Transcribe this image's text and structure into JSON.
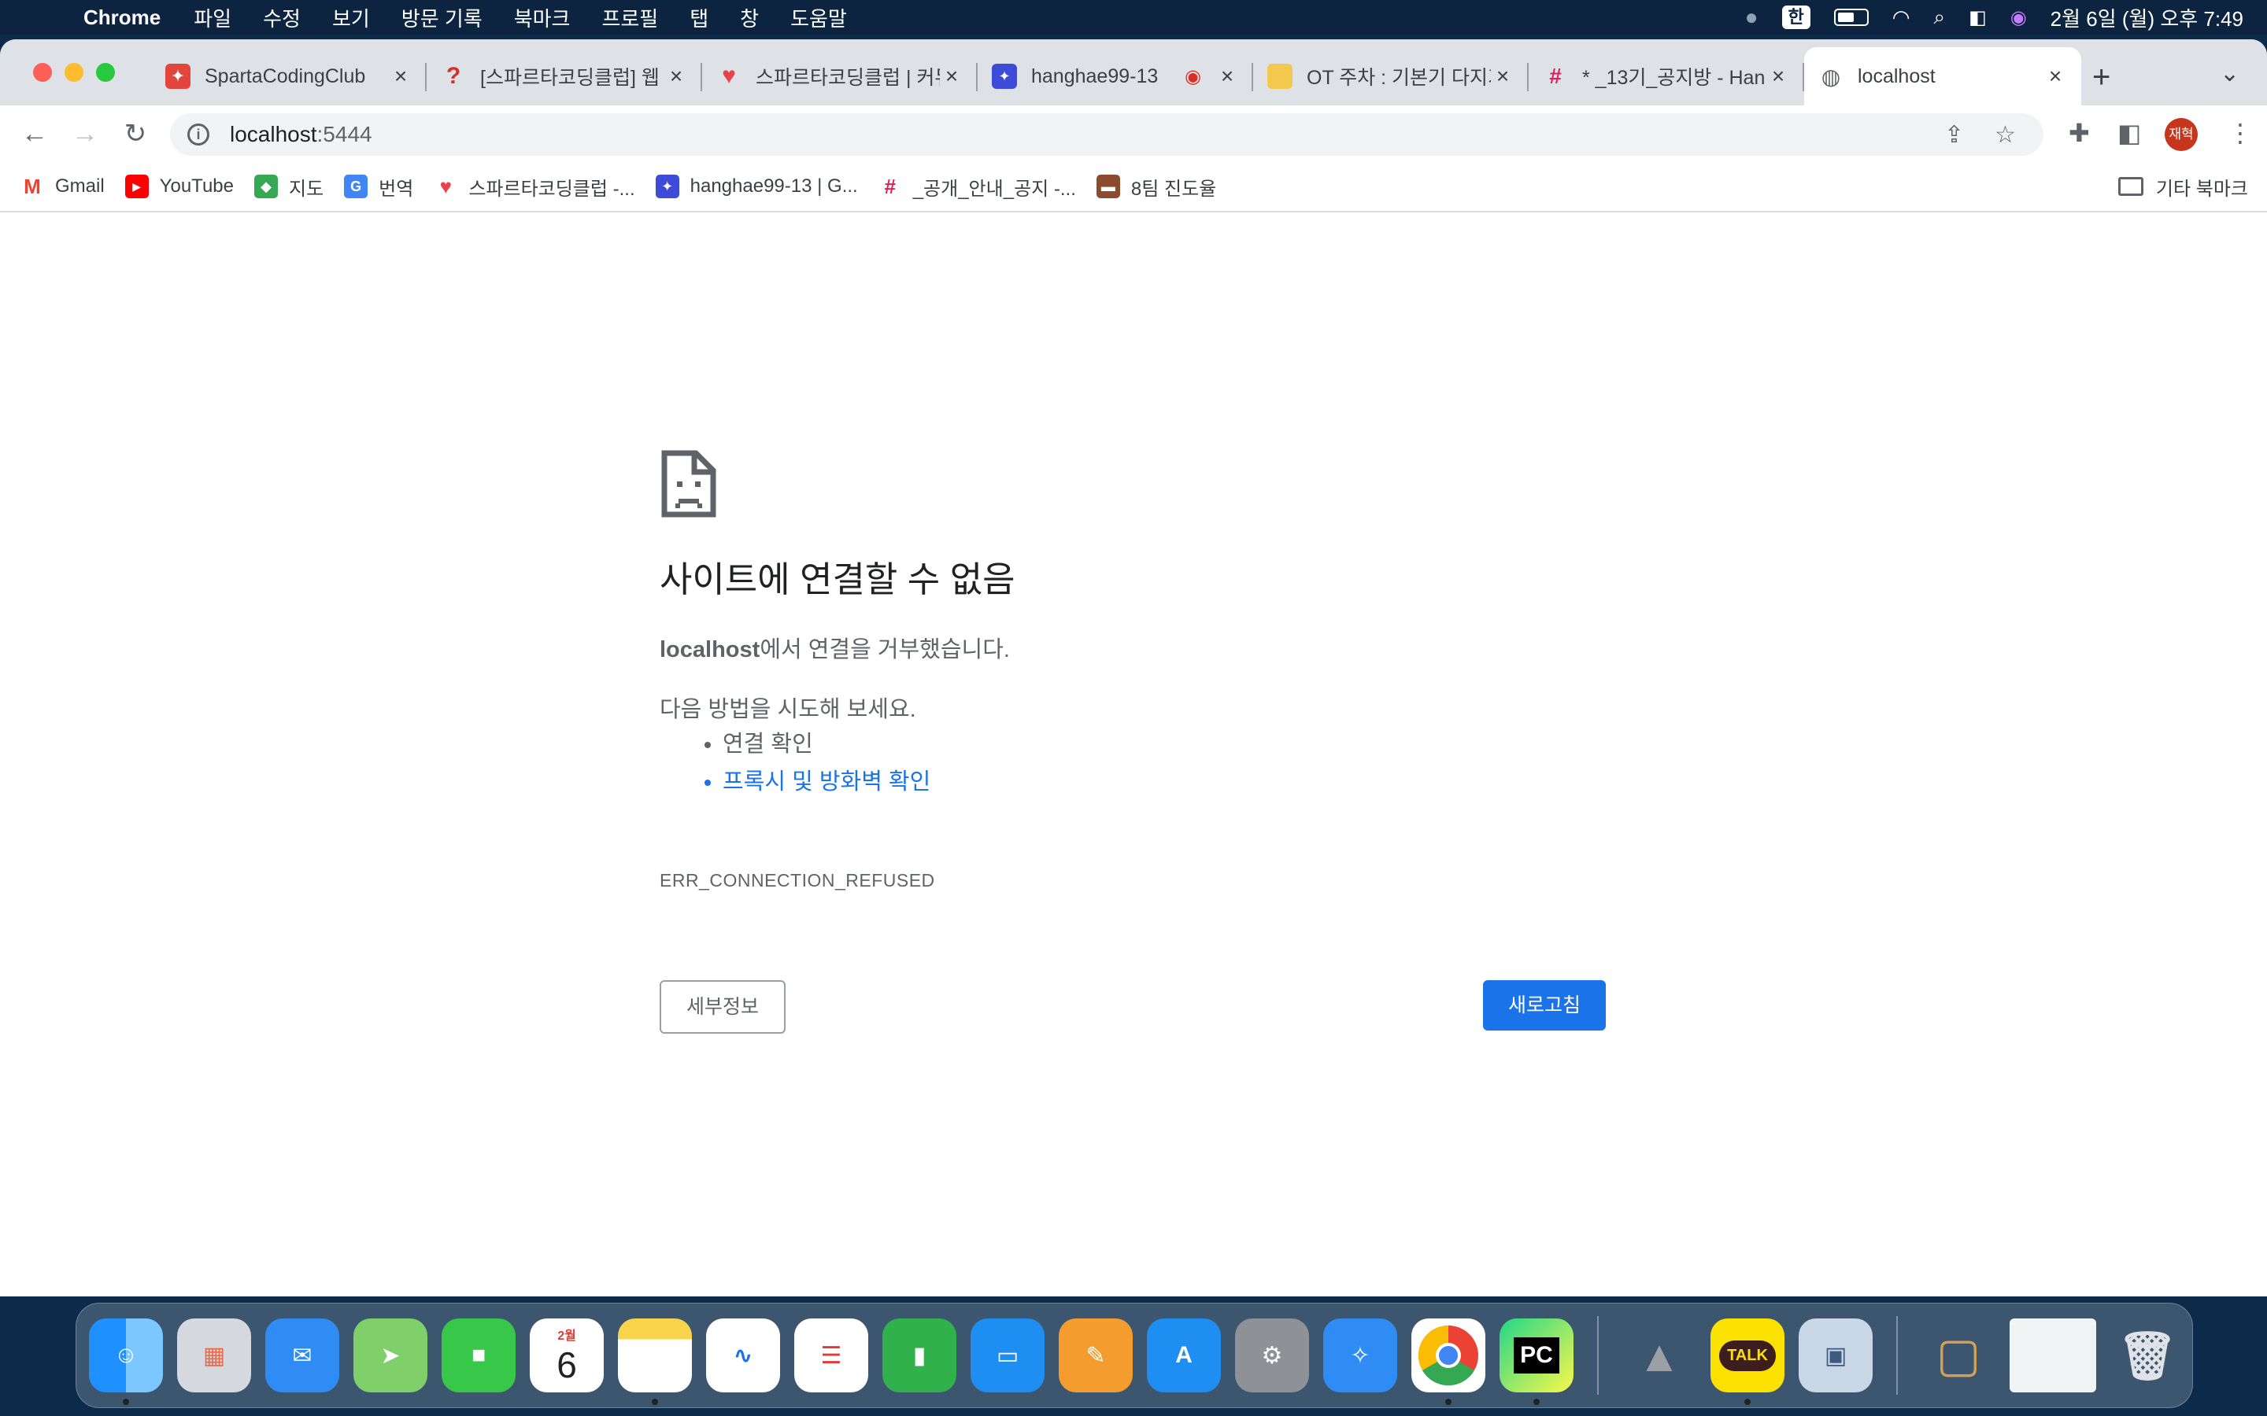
{
  "menubar": {
    "app_name": "Chrome",
    "items": [
      "파일",
      "수정",
      "보기",
      "방문 기록",
      "북마크",
      "프로필",
      "탭",
      "창",
      "도움말"
    ],
    "ime": "한",
    "clock": "2월 6일 (월) 오후 7:49"
  },
  "tabs": [
    {
      "title": "SpartaCodingClub",
      "color": "#e2453c"
    },
    {
      "title": "[스파르타코딩클럽] 웹",
      "color": "#d93025"
    },
    {
      "title": "스파르타코딩클럽 | 커뮤",
      "color": "#e8434a"
    },
    {
      "title": "hanghae99-13",
      "color": "#3d4bd9"
    },
    {
      "title": "OT 주차 : 기본기 다지기",
      "color": "#f2c94c"
    },
    {
      "title": "* _13기_공지방 - Han",
      "color": "#e01e5a"
    },
    {
      "title": "localhost",
      "color": "#5f6368"
    }
  ],
  "address": {
    "host": "localhost",
    "port": ":5444"
  },
  "bookmarks": [
    {
      "label": "Gmail",
      "color": "#ea4335",
      "glyph": "M"
    },
    {
      "label": "YouTube",
      "color": "#ff0000",
      "glyph": "▶"
    },
    {
      "label": "지도",
      "color": "#34a853",
      "glyph": "◆"
    },
    {
      "label": "번역",
      "color": "#4285f4",
      "glyph": "G"
    },
    {
      "label": "스파르타코딩클럽 -...",
      "color": "#e8434a",
      "glyph": "♥"
    },
    {
      "label": "hanghae99-13 | G...",
      "color": "#3d4bd9",
      "glyph": "✦"
    },
    {
      "label": "_공개_안내_공지 -...",
      "color": "#e01e5a",
      "glyph": "#"
    },
    {
      "label": "8팀 진도율",
      "color": "#8d4b2d",
      "glyph": "▬"
    }
  ],
  "other_bookmarks": "기타 북마크",
  "profile_name": "재혁",
  "error": {
    "title": "사이트에 연결할 수 없음",
    "host_bold": "localhost",
    "message_rest": "에서 연결을 거부했습니다.",
    "try_heading": "다음 방법을 시도해 보세요.",
    "suggestion_1": "연결 확인",
    "suggestion_2": "프록시 및 방화벽 확인",
    "code": "ERR_CONNECTION_REFUSED",
    "details_button": "세부정보",
    "reload_button": "새로고침"
  },
  "dock": {
    "calendar_month": "2월",
    "calendar_day": "6",
    "pycharm": "PC",
    "kakao": "TALK"
  }
}
